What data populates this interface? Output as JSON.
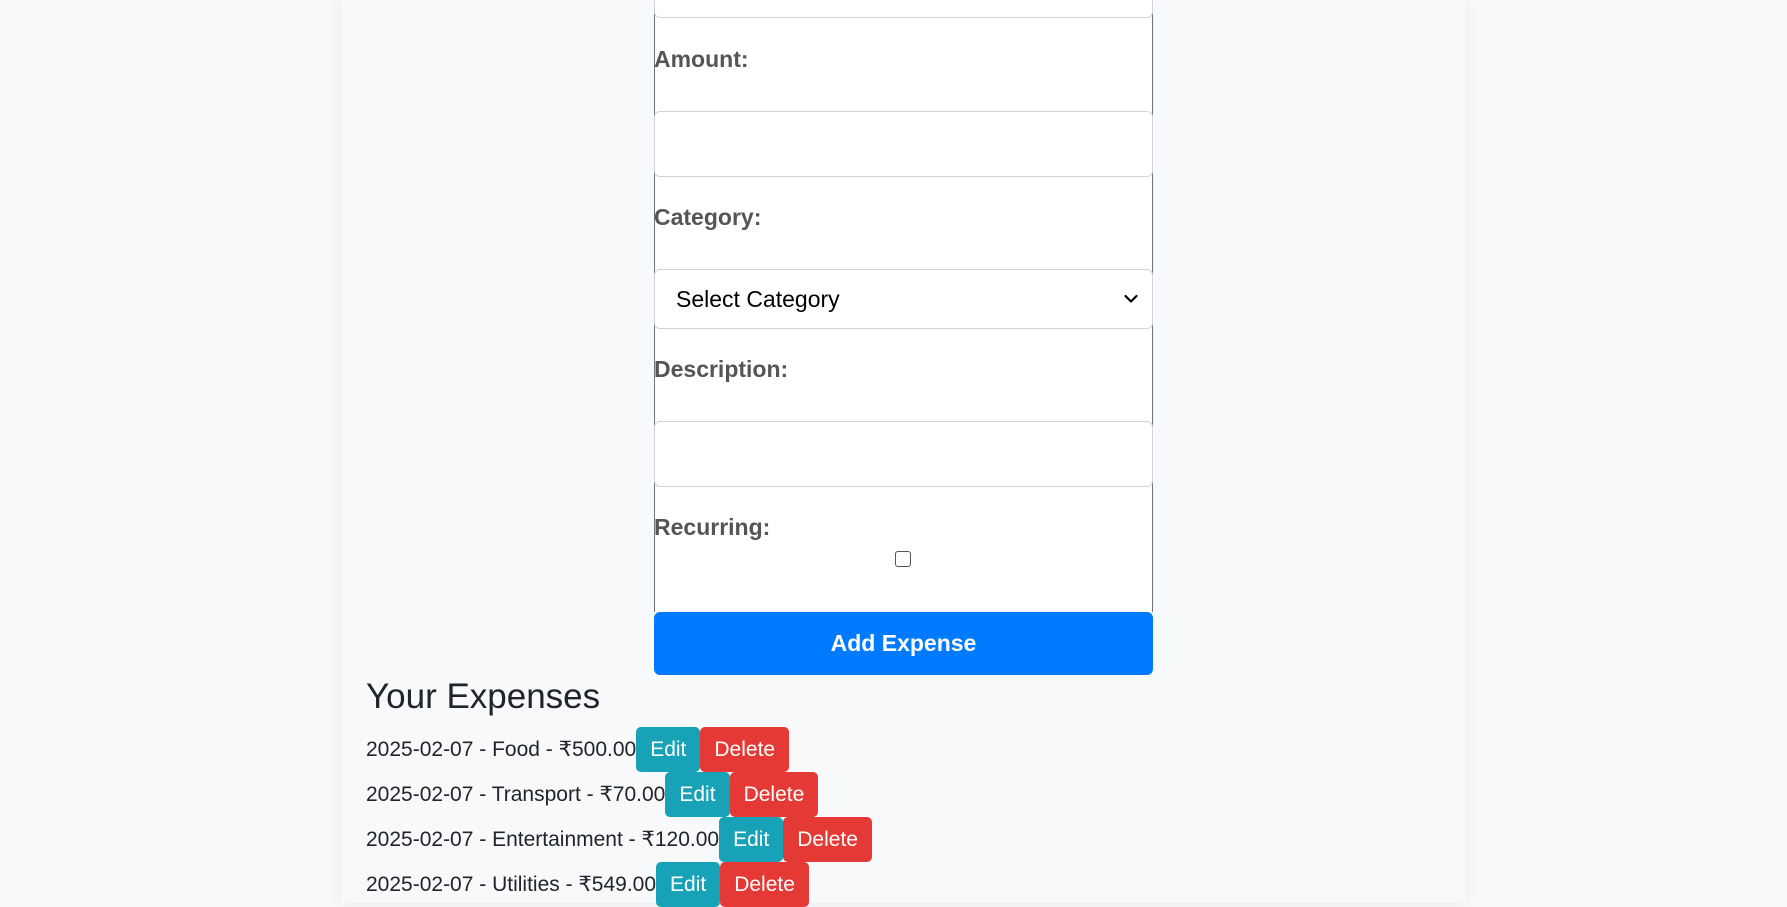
{
  "form": {
    "amount_label": "Amount:",
    "amount_value": "",
    "category_label": "Category:",
    "category_selected": "Select Category",
    "description_label": "Description:",
    "description_value": "",
    "recurring_label": "Recurring:",
    "submit_label": "Add Expense"
  },
  "expenses": {
    "title": "Your Expenses",
    "edit_label": "Edit",
    "delete_label": "Delete",
    "items": [
      {
        "text": "2025-02-07 - Food - ₹500.00"
      },
      {
        "text": "2025-02-07 - Transport - ₹70.00"
      },
      {
        "text": "2025-02-07 - Entertainment - ₹120.00"
      },
      {
        "text": "2025-02-07 - Utilities - ₹549.00"
      }
    ]
  },
  "colors": {
    "primary": "#007bff",
    "edit": "#17a2b8",
    "delete": "#e53935",
    "label": "#555555"
  },
  "icons": {
    "select_arrow": "chevron-down-icon"
  }
}
